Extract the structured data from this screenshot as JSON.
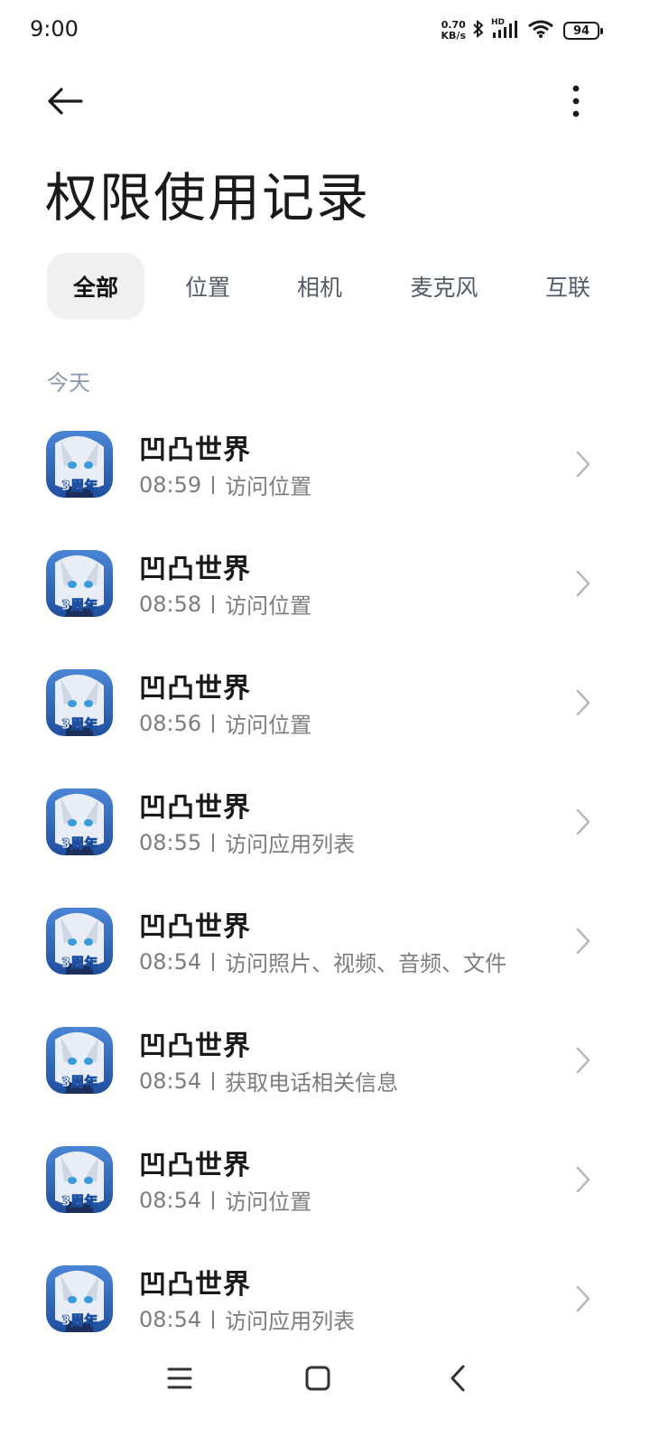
{
  "status_bar": {
    "time": "9:00",
    "speed_value": "0.70",
    "speed_unit": "KB/s",
    "network_label": "HD",
    "battery": "94"
  },
  "page": {
    "title": "权限使用记录"
  },
  "tabs": [
    {
      "label": "全部",
      "active": true
    },
    {
      "label": "位置",
      "active": false
    },
    {
      "label": "相机",
      "active": false
    },
    {
      "label": "麦克风",
      "active": false
    },
    {
      "label": "互联",
      "active": false
    }
  ],
  "section": {
    "today": "今天"
  },
  "items": [
    {
      "app": "凹凸世界",
      "time": "08:59",
      "action": "访问位置",
      "icon_badge": "3周年"
    },
    {
      "app": "凹凸世界",
      "time": "08:58",
      "action": "访问位置",
      "icon_badge": "3周年"
    },
    {
      "app": "凹凸世界",
      "time": "08:56",
      "action": "访问位置",
      "icon_badge": "3周年"
    },
    {
      "app": "凹凸世界",
      "time": "08:55",
      "action": "访问应用列表",
      "icon_badge": "3周年"
    },
    {
      "app": "凹凸世界",
      "time": "08:54",
      "action": "访问照片、视频、音频、文件",
      "icon_badge": "3周年"
    },
    {
      "app": "凹凸世界",
      "time": "08:54",
      "action": "获取电话相关信息",
      "icon_badge": "3周年"
    },
    {
      "app": "凹凸世界",
      "time": "08:54",
      "action": "访问位置",
      "icon_badge": "3周年"
    },
    {
      "app": "凹凸世界",
      "time": "08:54",
      "action": "访问应用列表",
      "icon_badge": "3周年"
    }
  ],
  "icons": {
    "back": "back-arrow-icon",
    "more": "more-vert-icon",
    "chevron": "chevron-right-icon",
    "menu": "menu-icon",
    "home": "home-icon",
    "nav_back": "nav-back-icon"
  },
  "colors": {
    "accent_text": "#1a1a1a",
    "secondary_text": "#7d7d7d",
    "section_header": "#8f99ad",
    "tab_active_bg": "#f0f0f0"
  }
}
